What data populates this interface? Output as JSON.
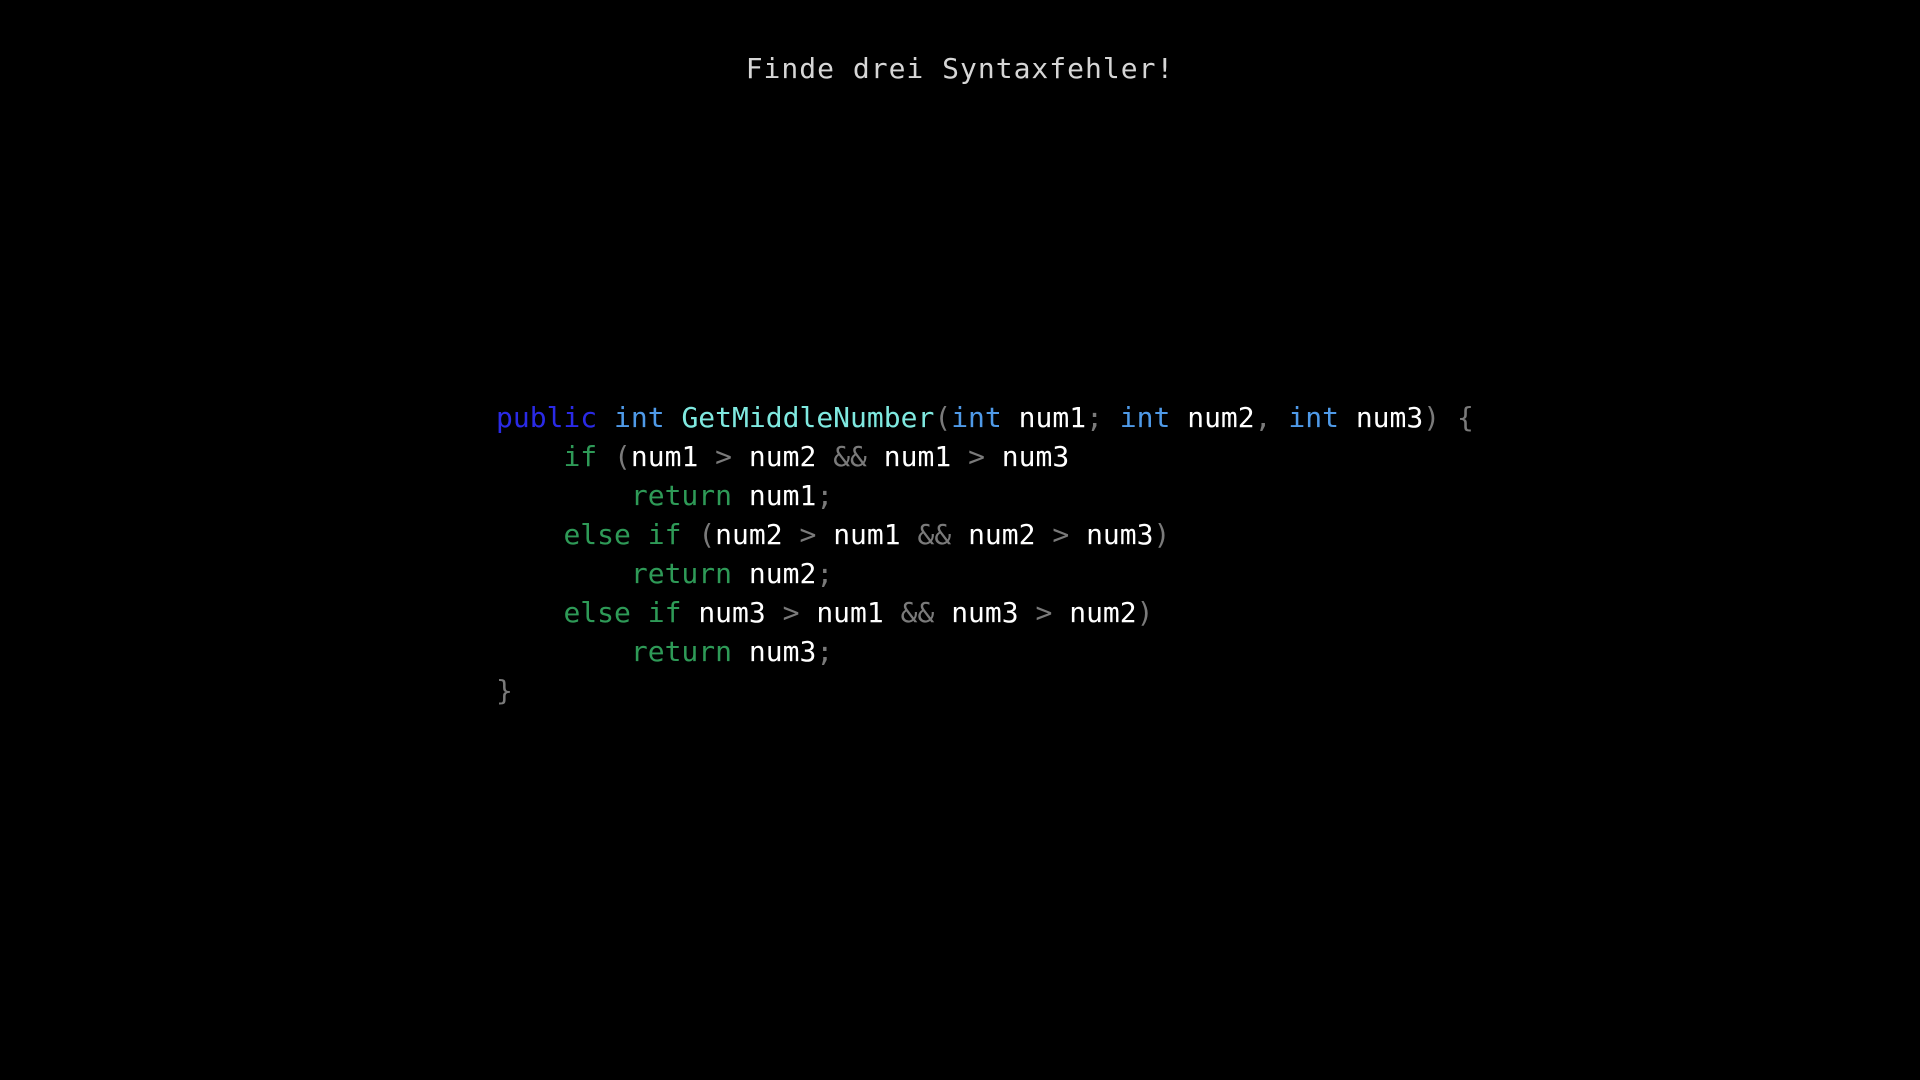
{
  "title": "Finde drei Syntaxfehler!",
  "colors": {
    "background": "#000000",
    "title": "#d6d6d6",
    "access_modifier": "#2a2ae6",
    "type_keyword": "#4f9ae8",
    "method_name": "#7fe9e0",
    "control_keyword": "#2e9a57",
    "identifier": "#ffffff",
    "punctuation": "#7a7a7a"
  },
  "code": {
    "lines": [
      {
        "tokens": [
          {
            "text": "public",
            "kind": "access_modifier"
          },
          {
            "text": " ",
            "kind": "space"
          },
          {
            "text": "int",
            "kind": "type_keyword"
          },
          {
            "text": " ",
            "kind": "space"
          },
          {
            "text": "GetMiddleNumber",
            "kind": "method_name"
          },
          {
            "text": "(",
            "kind": "punctuation"
          },
          {
            "text": "int",
            "kind": "type_keyword"
          },
          {
            "text": " ",
            "kind": "space"
          },
          {
            "text": "num1",
            "kind": "identifier"
          },
          {
            "text": ";",
            "kind": "punctuation"
          },
          {
            "text": " ",
            "kind": "space"
          },
          {
            "text": "int",
            "kind": "type_keyword"
          },
          {
            "text": " ",
            "kind": "space"
          },
          {
            "text": "num2",
            "kind": "identifier"
          },
          {
            "text": ",",
            "kind": "punctuation"
          },
          {
            "text": " ",
            "kind": "space"
          },
          {
            "text": "int",
            "kind": "type_keyword"
          },
          {
            "text": " ",
            "kind": "space"
          },
          {
            "text": "num3",
            "kind": "identifier"
          },
          {
            "text": ")",
            "kind": "punctuation"
          },
          {
            "text": " ",
            "kind": "space"
          },
          {
            "text": "{",
            "kind": "punctuation"
          }
        ]
      },
      {
        "tokens": [
          {
            "text": "    ",
            "kind": "space"
          },
          {
            "text": "if",
            "kind": "control_keyword"
          },
          {
            "text": " ",
            "kind": "space"
          },
          {
            "text": "(",
            "kind": "punctuation"
          },
          {
            "text": "num1",
            "kind": "identifier"
          },
          {
            "text": " ",
            "kind": "space"
          },
          {
            "text": ">",
            "kind": "punctuation"
          },
          {
            "text": " ",
            "kind": "space"
          },
          {
            "text": "num2",
            "kind": "identifier"
          },
          {
            "text": " ",
            "kind": "space"
          },
          {
            "text": "&&",
            "kind": "punctuation"
          },
          {
            "text": " ",
            "kind": "space"
          },
          {
            "text": "num1",
            "kind": "identifier"
          },
          {
            "text": " ",
            "kind": "space"
          },
          {
            "text": ">",
            "kind": "punctuation"
          },
          {
            "text": " ",
            "kind": "space"
          },
          {
            "text": "num3",
            "kind": "identifier"
          }
        ]
      },
      {
        "tokens": [
          {
            "text": "        ",
            "kind": "space"
          },
          {
            "text": "return",
            "kind": "control_keyword"
          },
          {
            "text": " ",
            "kind": "space"
          },
          {
            "text": "num1",
            "kind": "identifier"
          },
          {
            "text": ";",
            "kind": "punctuation"
          }
        ]
      },
      {
        "tokens": [
          {
            "text": "    ",
            "kind": "space"
          },
          {
            "text": "else",
            "kind": "control_keyword"
          },
          {
            "text": " ",
            "kind": "space"
          },
          {
            "text": "if",
            "kind": "control_keyword"
          },
          {
            "text": " ",
            "kind": "space"
          },
          {
            "text": "(",
            "kind": "punctuation"
          },
          {
            "text": "num2",
            "kind": "identifier"
          },
          {
            "text": " ",
            "kind": "space"
          },
          {
            "text": ">",
            "kind": "punctuation"
          },
          {
            "text": " ",
            "kind": "space"
          },
          {
            "text": "num1",
            "kind": "identifier"
          },
          {
            "text": " ",
            "kind": "space"
          },
          {
            "text": "&&",
            "kind": "punctuation"
          },
          {
            "text": " ",
            "kind": "space"
          },
          {
            "text": "num2",
            "kind": "identifier"
          },
          {
            "text": " ",
            "kind": "space"
          },
          {
            "text": ">",
            "kind": "punctuation"
          },
          {
            "text": " ",
            "kind": "space"
          },
          {
            "text": "num3",
            "kind": "identifier"
          },
          {
            "text": ")",
            "kind": "punctuation"
          }
        ]
      },
      {
        "tokens": [
          {
            "text": "        ",
            "kind": "space"
          },
          {
            "text": "return",
            "kind": "control_keyword"
          },
          {
            "text": " ",
            "kind": "space"
          },
          {
            "text": "num2",
            "kind": "identifier"
          },
          {
            "text": ";",
            "kind": "punctuation"
          }
        ]
      },
      {
        "tokens": [
          {
            "text": "    ",
            "kind": "space"
          },
          {
            "text": "else",
            "kind": "control_keyword"
          },
          {
            "text": " ",
            "kind": "space"
          },
          {
            "text": "if",
            "kind": "control_keyword"
          },
          {
            "text": " ",
            "kind": "space"
          },
          {
            "text": "num3",
            "kind": "identifier"
          },
          {
            "text": " ",
            "kind": "space"
          },
          {
            "text": ">",
            "kind": "punctuation"
          },
          {
            "text": " ",
            "kind": "space"
          },
          {
            "text": "num1",
            "kind": "identifier"
          },
          {
            "text": " ",
            "kind": "space"
          },
          {
            "text": "&&",
            "kind": "punctuation"
          },
          {
            "text": " ",
            "kind": "space"
          },
          {
            "text": "num3",
            "kind": "identifier"
          },
          {
            "text": " ",
            "kind": "space"
          },
          {
            "text": ">",
            "kind": "punctuation"
          },
          {
            "text": " ",
            "kind": "space"
          },
          {
            "text": "num2",
            "kind": "identifier"
          },
          {
            "text": ")",
            "kind": "punctuation"
          }
        ]
      },
      {
        "tokens": [
          {
            "text": "        ",
            "kind": "space"
          },
          {
            "text": "return",
            "kind": "control_keyword"
          },
          {
            "text": " ",
            "kind": "space"
          },
          {
            "text": "num3",
            "kind": "identifier"
          },
          {
            "text": ";",
            "kind": "punctuation"
          }
        ]
      },
      {
        "tokens": [
          {
            "text": "}",
            "kind": "punctuation"
          }
        ]
      }
    ]
  }
}
